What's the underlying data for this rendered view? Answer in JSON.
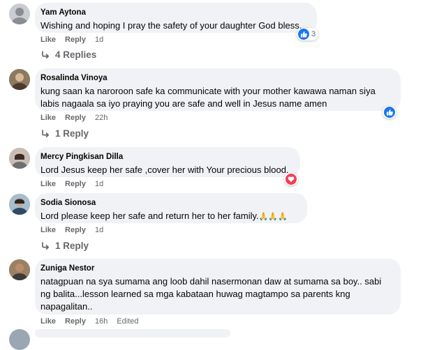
{
  "colors": {
    "bubble": "#f0f2f5",
    "meta": "#65676b",
    "like": "#1877f2",
    "love": "#f33e58"
  },
  "comments": [
    {
      "author": "Yam Aytona",
      "text": "Wishing and hoping I pray the safety of your daughter God bless.",
      "like": "Like",
      "reply": "Reply",
      "time": "1d",
      "reaction": {
        "icon": "like-icon",
        "count": "3"
      },
      "replies": "4 Replies"
    },
    {
      "author": "Rosalinda Vinoya",
      "text": "kung saan ka naroroon safe ka communicate with your mother kawawa naman siya labis nagaala sa iyo praying you are safe and well in Jesus name amen",
      "like": "Like",
      "reply": "Reply",
      "time": "22h",
      "reaction": {
        "icon": "like-icon"
      },
      "replies": "1 Reply"
    },
    {
      "author": "Mercy Pingkisan Dilla",
      "text": "Lord Jesus keep her safe ,cover her with Your precious blood.",
      "like": "Like",
      "reply": "Reply",
      "time": "1d",
      "reaction": {
        "icon": "love-icon"
      }
    },
    {
      "author": "Sodia Sionosa",
      "text": "Lord please keep her safe and return her to her family.",
      "emoji": "🙏🙏🙏",
      "like": "Like",
      "reply": "Reply",
      "time": "1d",
      "replies": "1 Reply"
    },
    {
      "author": "Zuniga Nestor",
      "text": "natagpuan na sya sumama ang loob dahil nasermonan daw at sumama sa boy.. sabi ng balita...lesson learned sa mga kabataan huwag magtampo sa parents kng napagalitan..",
      "like": "Like",
      "reply": "Reply",
      "time": "16h",
      "edited": "Edited"
    }
  ]
}
